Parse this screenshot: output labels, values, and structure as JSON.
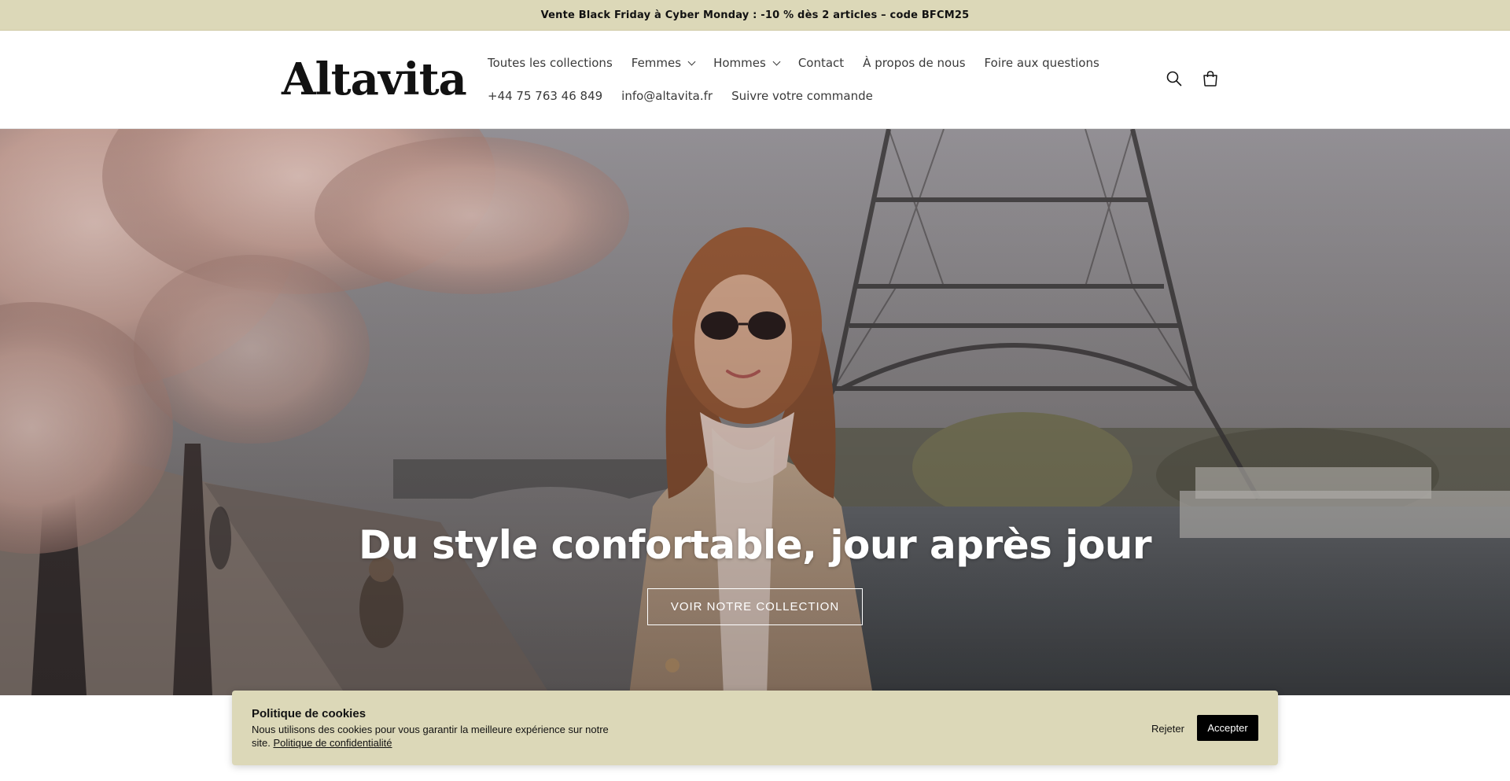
{
  "announcement": {
    "text": "Vente Black Friday à Cyber Monday : -10 % dès 2 articles – code BFCM25"
  },
  "header": {
    "logo": "Altavita",
    "nav_row1": [
      {
        "label": "Toutes les collections",
        "dropdown": false
      },
      {
        "label": "Femmes",
        "dropdown": true
      },
      {
        "label": "Hommes",
        "dropdown": true
      },
      {
        "label": "Contact",
        "dropdown": false
      },
      {
        "label": "À propos de nous",
        "dropdown": false
      },
      {
        "label": "Foire aux questions",
        "dropdown": false
      }
    ],
    "nav_row2": [
      {
        "label": "+44 75 763 46 849"
      },
      {
        "label": "info@altavita.fr"
      },
      {
        "label": "Suivre votre commande"
      }
    ],
    "icons": [
      "search-icon",
      "cart-icon"
    ]
  },
  "hero": {
    "title": "Du style confortable, jour après jour",
    "cta_label": "VOIR NOTRE COLLECTION"
  },
  "cookie_banner": {
    "title": "Politique de cookies",
    "text": "Nous utilisons des cookies pour vous garantir la meilleure expérience sur notre site.",
    "link_label": "Politique de confidentialité",
    "reject_label": "Rejeter",
    "accept_label": "Accepter"
  },
  "colors": {
    "announcement_bg": "#dcd8b8",
    "cookie_bg": "#dcd8b8",
    "accept_bg": "#000000"
  }
}
